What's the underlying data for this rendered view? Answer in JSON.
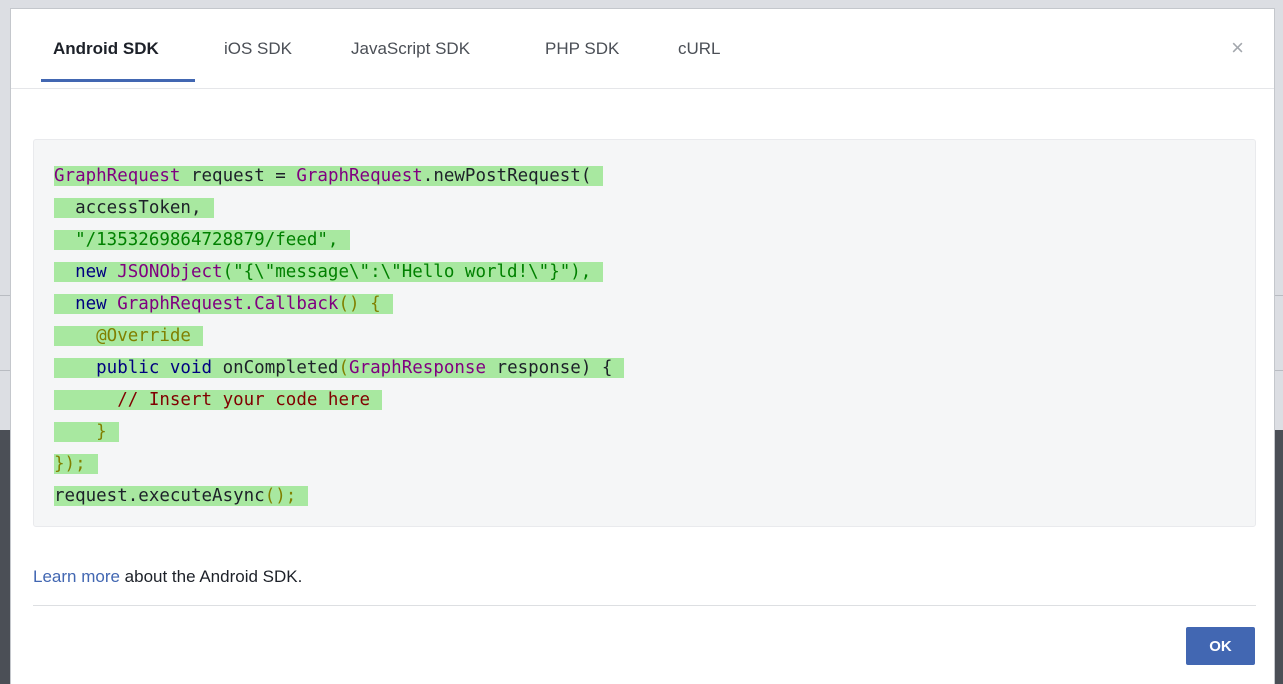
{
  "tabs": [
    {
      "label": "Android SDK",
      "active": true
    },
    {
      "label": "iOS SDK",
      "active": false
    },
    {
      "label": "JavaScript SDK",
      "active": false
    },
    {
      "label": "PHP SDK",
      "active": false
    },
    {
      "label": "cURL",
      "active": false
    }
  ],
  "close_label": "×",
  "code": {
    "highlight_color": "#a8e8a0",
    "lines": [
      {
        "t1": "GraphRequest",
        "t2": " request = ",
        "t3": "GraphRequest",
        "t4": ".newPostRequest("
      },
      {
        "t1": "  accessToken,"
      },
      {
        "t1": "  \"/1353269864728879/feed\","
      },
      {
        "t1": "  new ",
        "t2": "JSONObject",
        "t3": "(\"{\\\"message\\\":\\\"Hello world!\\\"}\"),"
      },
      {
        "t1": "  new ",
        "t2": "GraphRequest.Callback",
        "t3": "() {"
      },
      {
        "t1": "    @Override"
      },
      {
        "t1": "    public void ",
        "t2": "onCompleted",
        "t3": "(",
        "t4": "GraphResponse",
        "t5": " response) {"
      },
      {
        "t1": "      // Insert your code here"
      },
      {
        "t1": "    }"
      },
      {
        "t1": "});"
      },
      {
        "t1": "request.executeAsync",
        "t2": "();"
      }
    ]
  },
  "footer": {
    "link_text": "Learn more",
    "rest_text": " about the Android SDK."
  },
  "ok_label": "OK"
}
